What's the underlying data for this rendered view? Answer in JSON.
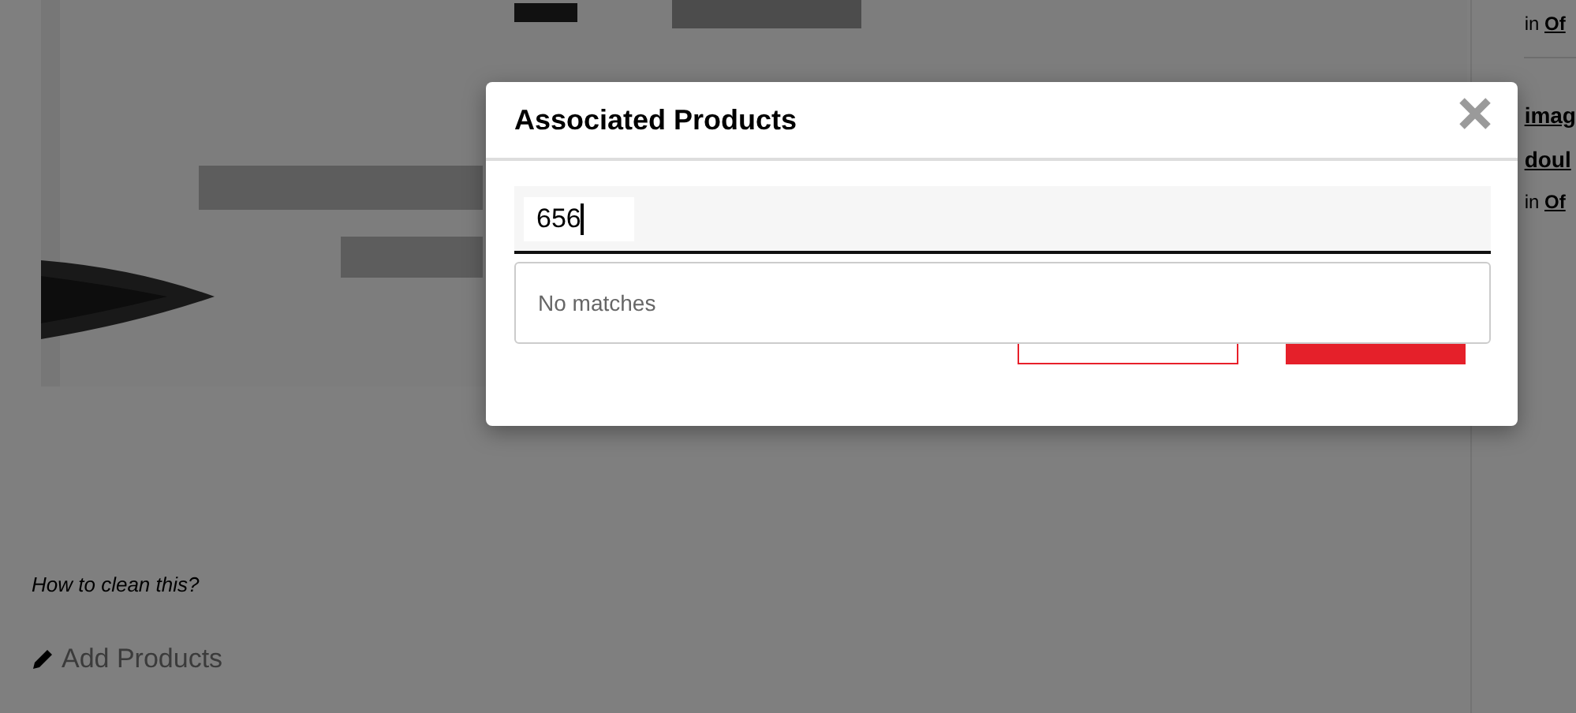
{
  "post": {
    "caption": "How to clean this?",
    "add_products": "Add Products"
  },
  "sidebar": {
    "items": [
      {
        "kind": "meta",
        "prefix": "in ",
        "link": "Of"
      },
      {
        "kind": "title",
        "link": "imag"
      },
      {
        "kind": "title",
        "link": "doul"
      },
      {
        "kind": "meta",
        "prefix": "in ",
        "link": "Of"
      }
    ]
  },
  "modal": {
    "title": "Associated Products",
    "search": {
      "value": "656"
    },
    "dropdown": {
      "message": "No matches"
    },
    "buttons": [
      {
        "kind": "outline"
      },
      {
        "kind": "filled"
      }
    ]
  }
}
